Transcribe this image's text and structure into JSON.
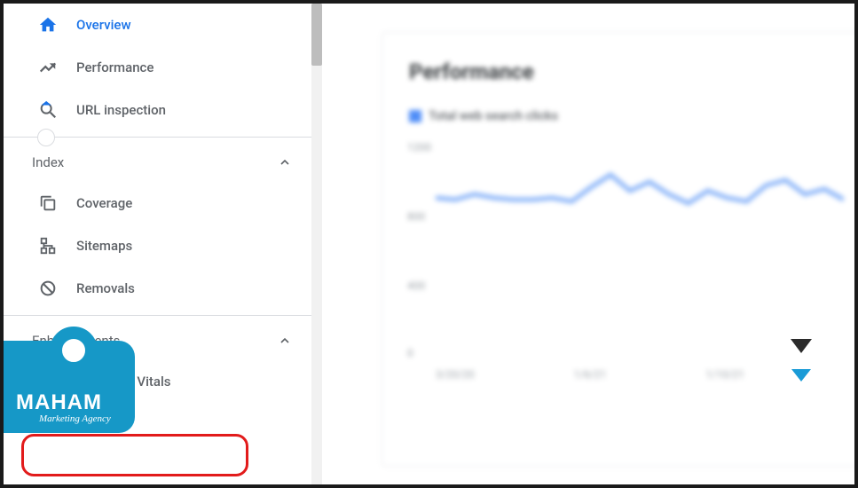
{
  "sidebar": {
    "items": [
      {
        "label": "Overview"
      },
      {
        "label": "Performance"
      },
      {
        "label": "URL inspection"
      }
    ],
    "sections": [
      {
        "label": "Index",
        "items": [
          {
            "label": "Coverage"
          },
          {
            "label": "Sitemaps"
          },
          {
            "label": "Removals"
          }
        ]
      },
      {
        "label": "Enhancements",
        "items": [
          {
            "label": "Core Web Vitals"
          }
        ]
      }
    ]
  },
  "main": {
    "card_title": "Performance",
    "legend": "Total web search clicks"
  },
  "chart_data": {
    "type": "line",
    "title": "Performance",
    "series": [
      {
        "name": "Total web search clicks",
        "values": [
          880,
          870,
          900,
          880,
          870,
          870,
          880,
          860,
          940,
          1010,
          920,
          970,
          900,
          850,
          920,
          880,
          860,
          950,
          980,
          900,
          930,
          870
        ]
      }
    ],
    "x_ticks": [
      "3/20/20",
      "1/6/21",
      "1/10/21",
      ""
    ],
    "y_ticks": [
      1200,
      800,
      400,
      0
    ],
    "ylim": [
      0,
      1200
    ]
  },
  "logo": {
    "name": "MAHAM",
    "tag": "Marketing Agency"
  }
}
